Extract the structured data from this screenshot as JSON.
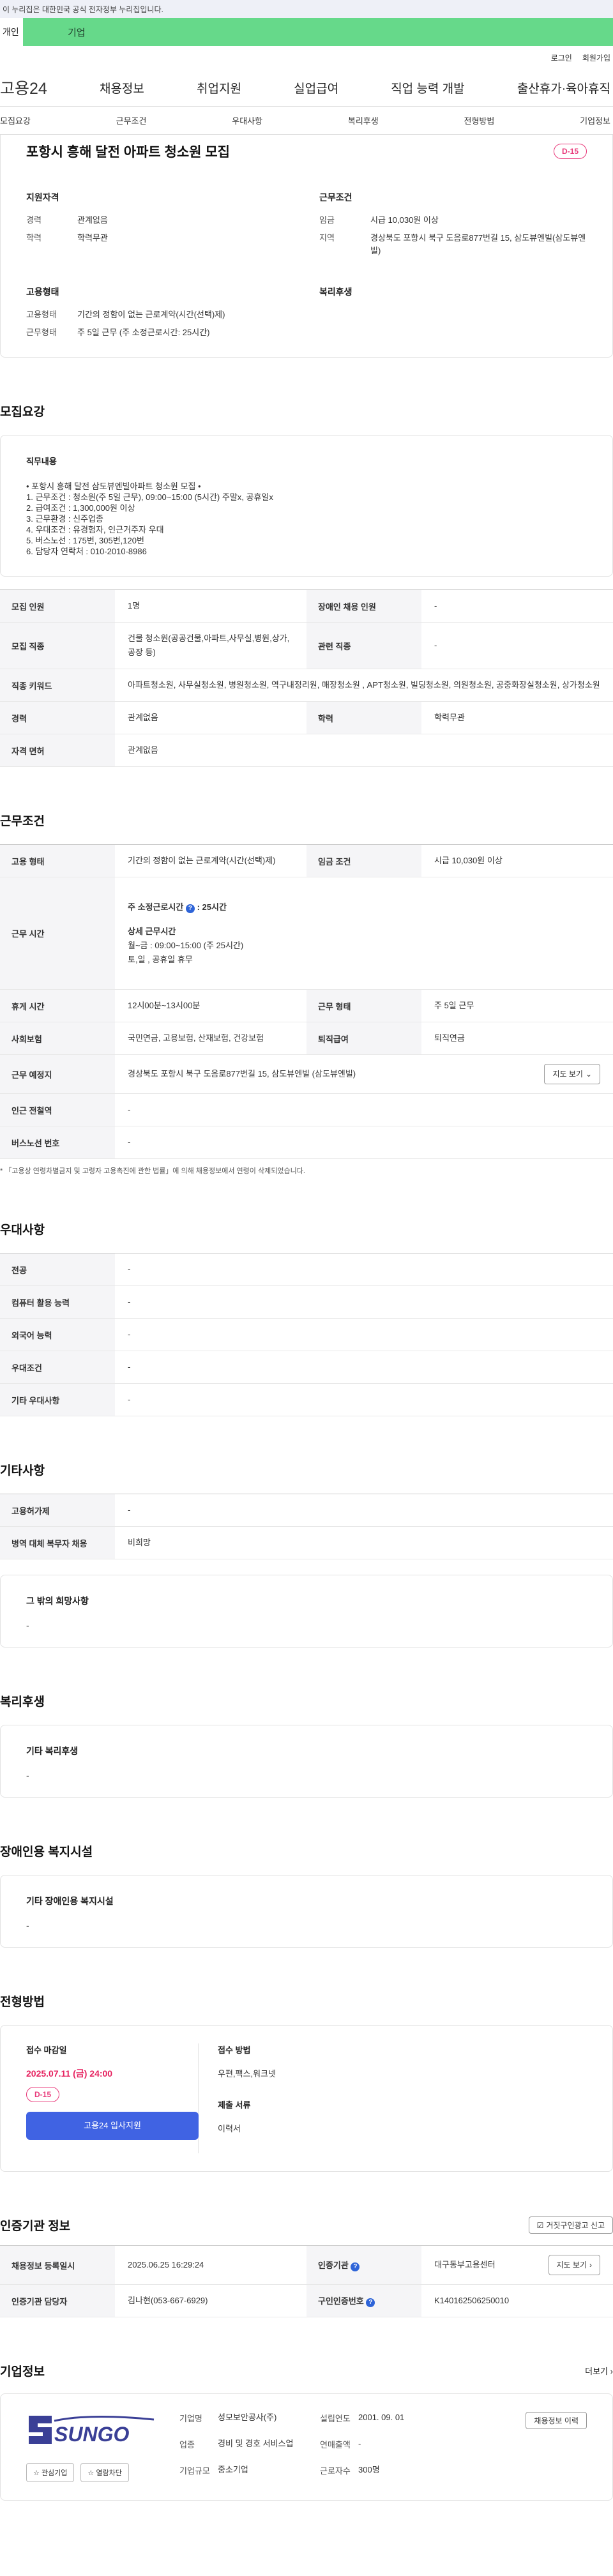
{
  "gov_banner": "이 누리집은 대한민국 공식 전자정부 누리집입니다.",
  "tabs": {
    "individual": "개인",
    "business": "기업"
  },
  "util_links": [
    "로그인",
    "회원가입"
  ],
  "gnb": {
    "logo": "고용24",
    "menus": [
      "채용정보",
      "취업지원",
      "실업급여",
      "직업 능력 개발",
      "출산휴가·육아휴직"
    ]
  },
  "anchor_nav": [
    "모집요강",
    "근무조건",
    "우대사항",
    "복리후생",
    "전형방법",
    "기업정보"
  ],
  "summary": {
    "title": "포항시 흥해 달전 아파트 청소원 모집",
    "dday": "D-15",
    "qualification": {
      "heading": "지원자격",
      "items": [
        {
          "k": "경력",
          "v": "관계없음"
        },
        {
          "k": "학력",
          "v": "학력무관"
        }
      ]
    },
    "conditions": {
      "heading": "근무조건",
      "items": [
        {
          "k": "임금",
          "v": "시급 10,030원 이상"
        },
        {
          "k": "지역",
          "v": "경상북도 포항시 북구 도음로877번길 15, 삼도뷰엔빌(삼도뷰엔빌)"
        }
      ]
    },
    "employment": {
      "heading": "고용형태",
      "items": [
        {
          "k": "고용형태",
          "v": "기간의 정함이 없는 근로계약(시간(선택)제)"
        },
        {
          "k": "근무형태",
          "v": "주 5일 근무 (주 소정근로시간: 25시간)"
        }
      ]
    },
    "welfare": {
      "heading": "복리후생"
    }
  },
  "recruit": {
    "heading": "모집요강",
    "duty_title": "직무내용",
    "duty_lines": [
      "• 포항시 흥해 달전 삼도뷰엔빌아파트 청소원 모집 •",
      "1. 근무조건 : 청소원(주 5일 근무), 09:00~15:00 (5시간)  주말x, 공휴일x",
      "2. 급여조건 : 1,300,000원 이상",
      "3. 근무환경 : 신주업종",
      "4. 우대조건 : 유경험자, 인근거주자 우대",
      "5. 버스노선 : 175번, 305번,120번",
      "6. 담당자 연락처 : 010-2010-8986"
    ],
    "table": {
      "headcount_k": "모집 인원",
      "headcount_v": "1명",
      "disabled_k": "장애인 채용 인원",
      "disabled_v": "-",
      "job_k": "모집 직종",
      "job_v": "건물 청소원(공공건물,아파트,사무실,병원,상가,공장 등)",
      "related_k": "관련 직종",
      "related_v": "-",
      "keyword_k": "직종 키워드",
      "keyword_v": "아파트청소원, 사무실청소원, 병원청소원, 역구내정리원, 매장청소원 , APT청소원, 빌딩청소원, 의원청소원, 공중화장실청소원, 상가청소원",
      "career_k": "경력",
      "career_v": "관계없음",
      "edu_k": "학력",
      "edu_v": "학력무관",
      "license_k": "자격 면허",
      "license_v": "관계없음"
    }
  },
  "work": {
    "heading": "근무조건",
    "type_k": "고용 형태",
    "type_v": "기간의 정함이 없는 근로계약(시간(선택)제)",
    "wage_k": "임금 조건",
    "wage_v": "시급 10,030원 이상",
    "hours_k": "근무 시간",
    "hours_prescribed": "주 소정근로시간",
    "hours_value": ": 25시간",
    "hours_detail_title": "상세 근무시간",
    "hours_detail": "월~금 : 09:00~15:00 (주 25시간)",
    "hours_off": "토,일 , 공휴일 휴무",
    "break_k": "휴게 시간",
    "break_v": "12시00분~13시00분",
    "form_k": "근무 형태",
    "form_v": "주 5일 근무",
    "insurance_k": "사회보험",
    "insurance_v": "국민연금, 고용보험, 산재보험, 건강보험",
    "severance_k": "퇴직급여",
    "severance_v": "퇴직연금",
    "location_k": "근무 예정지",
    "location_v": "경상북도 포항시 북구 도음로877번길 15, 삼도뷰엔빌 (삼도뷰엔빌)",
    "map_button": "지도 보기",
    "subway_k": "인근 전철역",
    "subway_v": "-",
    "bus_k": "버스노선 번호",
    "bus_v": "-",
    "note": "* 「고용상 연령차별금지 및 고령자 고용촉진에 관한 법률」에 의해 채용정보에서 연령이 삭제되었습니다."
  },
  "preference": {
    "heading": "우대사항",
    "rows": [
      {
        "k": "전공",
        "v": "-"
      },
      {
        "k": "컴퓨터 활용 능력",
        "v": "-"
      },
      {
        "k": "외국어 능력",
        "v": "-"
      },
      {
        "k": "우대조건",
        "v": "-"
      },
      {
        "k": "기타 우대사항",
        "v": "-"
      }
    ]
  },
  "etc": {
    "heading": "기타사항",
    "rows": [
      {
        "k": "고용허가제",
        "v": "-"
      },
      {
        "k": "병역 대체 복무자 채용",
        "v": "비희망"
      }
    ],
    "other_title": "그 밖의 희망사항",
    "other_value": "-"
  },
  "welfare": {
    "heading": "복리후생",
    "title": "기타 복리후생",
    "value": "-"
  },
  "facility": {
    "heading": "장애인용 복지시설",
    "title": "기타 장애인용 복지시설",
    "value": "-"
  },
  "process": {
    "heading": "전형방법",
    "deadline_label": "접수 마감일",
    "deadline": "2025.07.11 (금) 24:00",
    "dday": "D-15",
    "apply_button": "고용24 입사지원",
    "method_label": "접수 방법",
    "method_value": "우편,팩스,워크넷",
    "docs_label": "제출 서류",
    "docs_value": "이력서"
  },
  "agency": {
    "heading": "인증기관 정보",
    "report_button": "거짓구인광고 신고",
    "reg_k": "채용정보 등록일시",
    "reg_v": "2025.06.25 16:29:24",
    "org_k": "인증기관",
    "org_v": "대구동부고용센터",
    "map_button": "지도 보기",
    "manager_k": "인증기관 담당자",
    "manager_v": "김나현(053-667-6929)",
    "id_k": "구인인증번호",
    "id_v": "K140162506250010"
  },
  "company": {
    "heading": "기업정보",
    "more": "더보기",
    "logo_text": "SUNGO",
    "fav_button": "관심기업",
    "block_button": "열람차단",
    "name_k": "기업명",
    "name_v": "성모보안공사(주)",
    "founded_k": "설립연도",
    "founded_v": "2001. 09. 01",
    "industry_k": "업종",
    "industry_v": "경비 및 경호 서비스업",
    "revenue_k": "연매출액",
    "revenue_v": "-",
    "employees_k": "근로자수",
    "employees_v": "300명",
    "size_k": "기업규모",
    "size_v": "중소기업",
    "other_jobs_button": "채용정보 이력"
  }
}
